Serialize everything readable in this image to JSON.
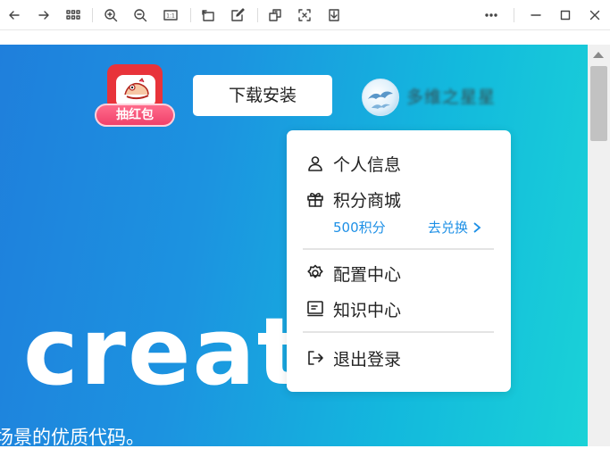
{
  "toolbar": {
    "buttons": [
      "back-icon",
      "forward-icon",
      "grid-icon",
      "zoom-in-icon",
      "zoom-out-icon",
      "actual-size-icon",
      "rotate-icon",
      "edit-icon",
      "copy-icon",
      "scan-icon",
      "download-icon",
      "more-icon",
      "minimize-icon",
      "maximize-icon",
      "close-icon"
    ],
    "zoom_label": "1:1"
  },
  "header": {
    "hongbao_label": "抽红包",
    "install_button": "下载安装",
    "username": "多维之星星"
  },
  "banner": {
    "big_text": "create",
    "subtitle": "场景的优质代码。"
  },
  "menu": {
    "items": [
      {
        "label": "个人信息",
        "icon": "user-icon"
      },
      {
        "label": "积分商城",
        "icon": "gift-icon"
      },
      {
        "label": "配置中心",
        "icon": "settings-icon"
      },
      {
        "label": "知识中心",
        "icon": "book-icon"
      },
      {
        "label": "退出登录",
        "icon": "logout-icon"
      }
    ],
    "points": "500积分",
    "exchange": "去兑换"
  },
  "colors": {
    "accent": "#1e90e6",
    "banner_start": "#1f7fdc",
    "banner_end": "#1ad2d7",
    "hongbao_red": "#e8333a"
  }
}
